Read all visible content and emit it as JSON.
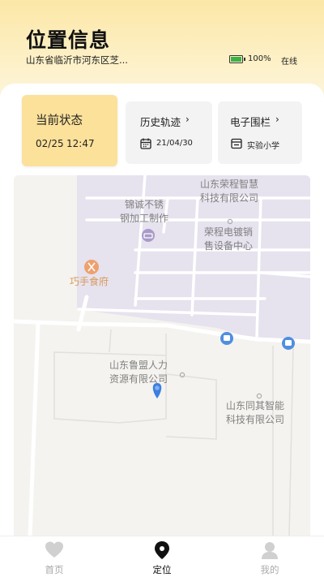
{
  "header": {
    "title": "位置信息",
    "address": "山东省临沂市河东区芝...",
    "battery": "100%",
    "online_status": "在线",
    "battery_color": "#3bb34a"
  },
  "status_card": {
    "label": "当前状态",
    "date": "02/25",
    "time": "12:47",
    "background": "#fbe19a"
  },
  "history_card": {
    "title": "历史轨迹",
    "chevron": "›",
    "icon": "calendar-icon",
    "sub": "21/04/30"
  },
  "fence_card": {
    "title": "电子围栏",
    "chevron": "›",
    "icon": "fence-icon",
    "sub": "实验小学"
  },
  "map": {
    "labels": {
      "rongcheng_zhihui_1": "山东荣程智慧",
      "rongcheng_zhihui_2": "科技有限公司",
      "jincheng_1": "锦诚不锈",
      "jincheng_2": "钢加工制作",
      "rongcheng_dianti_1": "荣程电镀销",
      "rongcheng_dianti_2": "售设备中心",
      "qiaoshou": "巧手食府",
      "lumeng_1": "山东鲁盟人力",
      "lumeng_2": "资源有限公司",
      "tongqi_1": "山东同其智能",
      "tongqi_2": "科技有限公司"
    },
    "colors": {
      "zone": "#e6e2ee",
      "background": "#f4f3ef",
      "road": "#ffffff",
      "pin": "#3d7fe0",
      "bus": "#4e8fe0"
    }
  },
  "tabbar": {
    "tabs": [
      {
        "label": "首页",
        "icon": "heart-icon"
      },
      {
        "label": "定位",
        "icon": "location-pin-icon"
      },
      {
        "label": "我的",
        "icon": "user-icon"
      }
    ],
    "active": "定位"
  }
}
